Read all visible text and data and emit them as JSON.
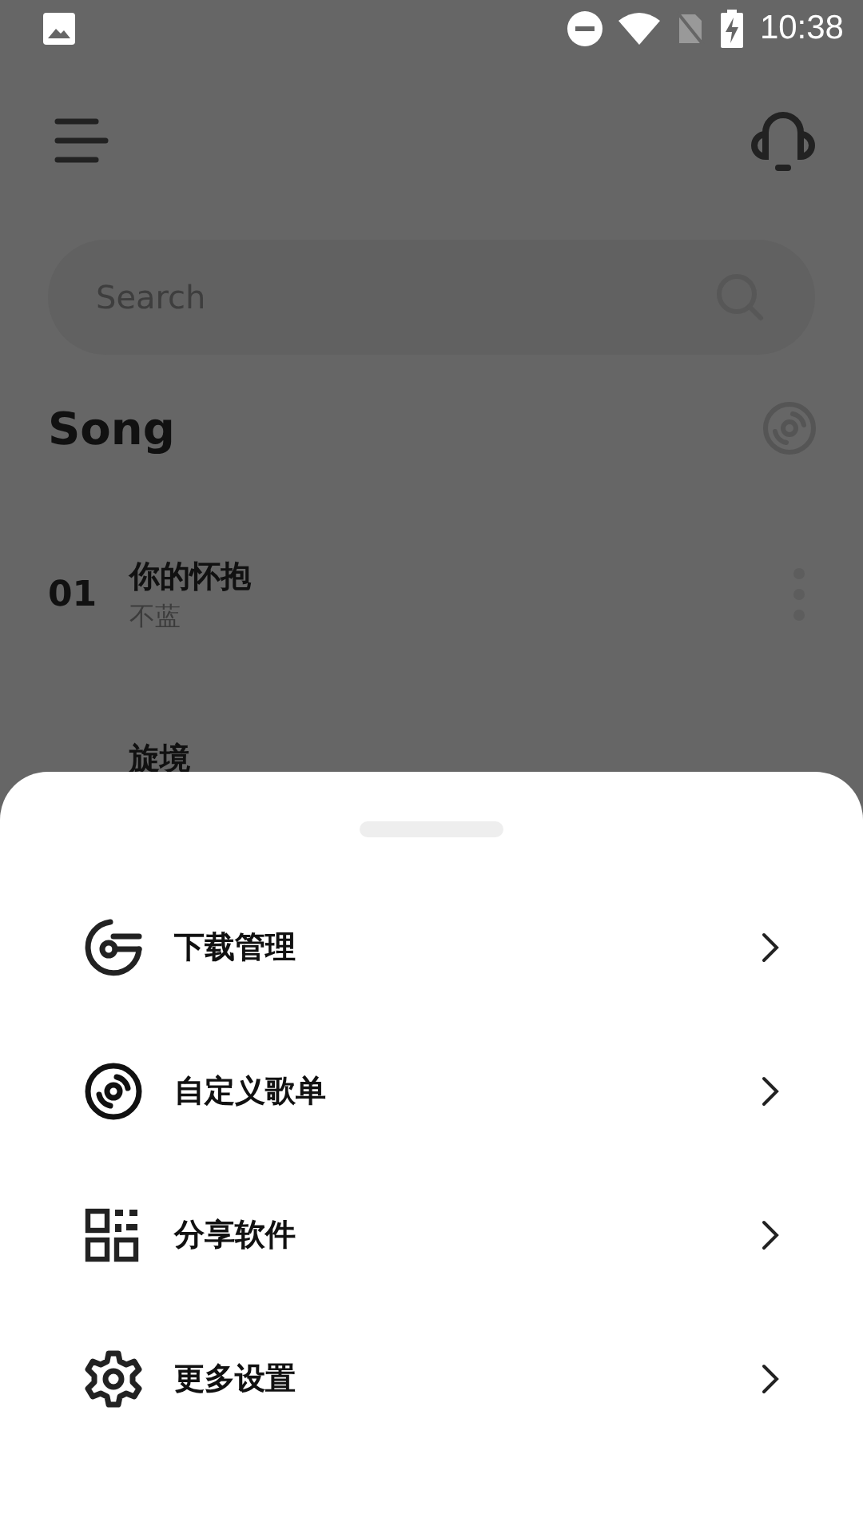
{
  "status_bar": {
    "time": "10:38"
  },
  "search": {
    "placeholder": "Search"
  },
  "section": {
    "title": "Song"
  },
  "songs": [
    {
      "number": "01",
      "title": "你的怀抱",
      "artist": "不蓝"
    },
    {
      "title": "旋境"
    }
  ],
  "sheet": {
    "items": [
      {
        "kind": "download",
        "label": "下载管理"
      },
      {
        "kind": "playlist",
        "label": "自定义歌单"
      },
      {
        "kind": "share",
        "label": "分享软件"
      },
      {
        "kind": "settings",
        "label": "更多设置"
      }
    ]
  }
}
